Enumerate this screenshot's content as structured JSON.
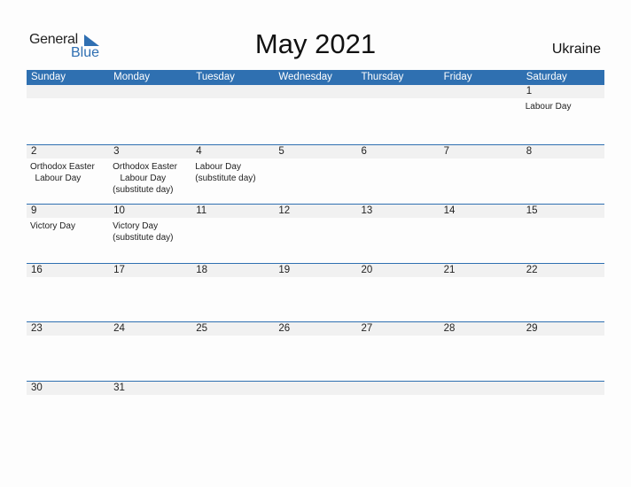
{
  "logo": {
    "word1": "General",
    "word2": "Blue"
  },
  "title": "May 2021",
  "country": "Ukraine",
  "colors": {
    "accent": "#2f70b1",
    "date_row_bg": "#f1f1f1"
  },
  "weekdays": [
    "Sunday",
    "Monday",
    "Tuesday",
    "Wednesday",
    "Thursday",
    "Friday",
    "Saturday"
  ],
  "weeks": [
    [
      {
        "num": "",
        "hol": ""
      },
      {
        "num": "",
        "hol": ""
      },
      {
        "num": "",
        "hol": ""
      },
      {
        "num": "",
        "hol": ""
      },
      {
        "num": "",
        "hol": ""
      },
      {
        "num": "",
        "hol": ""
      },
      {
        "num": "1",
        "hol": "Labour Day"
      }
    ],
    [
      {
        "num": "2",
        "hol": "Orthodox Easter\n  Labour Day"
      },
      {
        "num": "3",
        "hol": "Orthodox Easter\n   Labour Day\n(substitute day)"
      },
      {
        "num": "4",
        "hol": "Labour Day\n(substitute day)"
      },
      {
        "num": "5",
        "hol": ""
      },
      {
        "num": "6",
        "hol": ""
      },
      {
        "num": "7",
        "hol": ""
      },
      {
        "num": "8",
        "hol": ""
      }
    ],
    [
      {
        "num": "9",
        "hol": "Victory Day"
      },
      {
        "num": "10",
        "hol": "Victory Day\n(substitute day)"
      },
      {
        "num": "11",
        "hol": ""
      },
      {
        "num": "12",
        "hol": ""
      },
      {
        "num": "13",
        "hol": ""
      },
      {
        "num": "14",
        "hol": ""
      },
      {
        "num": "15",
        "hol": ""
      }
    ],
    [
      {
        "num": "16",
        "hol": ""
      },
      {
        "num": "17",
        "hol": ""
      },
      {
        "num": "18",
        "hol": ""
      },
      {
        "num": "19",
        "hol": ""
      },
      {
        "num": "20",
        "hol": ""
      },
      {
        "num": "21",
        "hol": ""
      },
      {
        "num": "22",
        "hol": ""
      }
    ],
    [
      {
        "num": "23",
        "hol": ""
      },
      {
        "num": "24",
        "hol": ""
      },
      {
        "num": "25",
        "hol": ""
      },
      {
        "num": "26",
        "hol": ""
      },
      {
        "num": "27",
        "hol": ""
      },
      {
        "num": "28",
        "hol": ""
      },
      {
        "num": "29",
        "hol": ""
      }
    ],
    [
      {
        "num": "30",
        "hol": ""
      },
      {
        "num": "31",
        "hol": ""
      },
      {
        "num": "",
        "hol": ""
      },
      {
        "num": "",
        "hol": ""
      },
      {
        "num": "",
        "hol": ""
      },
      {
        "num": "",
        "hol": ""
      },
      {
        "num": "",
        "hol": ""
      }
    ]
  ]
}
